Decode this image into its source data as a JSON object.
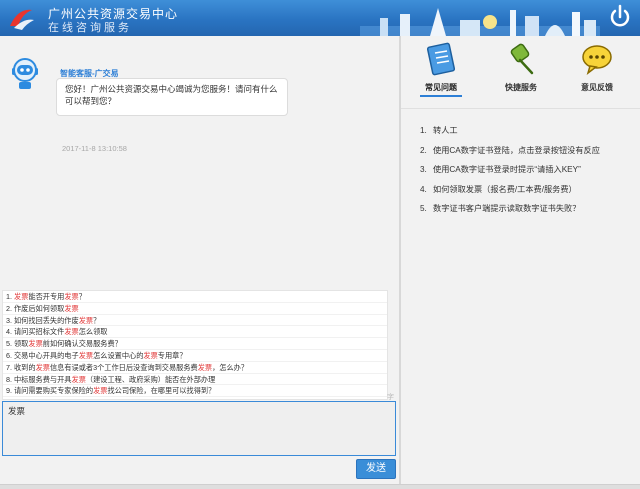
{
  "header": {
    "title_line1": "广州公共资源交易中心",
    "title_line2": "在线咨询服务"
  },
  "chat": {
    "agent_name": "智能客服-广交易",
    "greeting": "您好！广州公共资源交易中心竭诚为您服务！请问有什么可以帮到您？",
    "timestamp": "2017-11-8 13:10:58"
  },
  "suggestions": [
    [
      "1. ",
      "发票",
      "能否开专用",
      "发票",
      "？"
    ],
    [
      "2. 作废后如何领取",
      "发票",
      ""
    ],
    [
      "3. 如何找回丢失的作废",
      "发票",
      "？"
    ],
    [
      "4. 请问买招标文件",
      "发票",
      "怎么领取"
    ],
    [
      "5. 领取",
      "发票",
      "前如何确认交易服务费？"
    ],
    [
      "6. 交易中心开具的电子",
      "发票",
      "怎么设置中心的",
      "发票",
      "专用章？"
    ],
    [
      "7. 收到的",
      "发票",
      "信息有误或者3个工作日后没查询到交易服务费",
      "发票",
      "，怎么办？"
    ],
    [
      "8. 中标服务费与开具",
      "发票",
      "（建设工程、政府采购）能否在外部办理"
    ],
    [
      "9. 请问需要购买专家保险的",
      "发票",
      "找公司保险，在哪里可以找得到？"
    ]
  ],
  "input": {
    "value": "发票"
  },
  "send_label": "发送",
  "send_hint": "字",
  "tabs": [
    {
      "label": "常见问题",
      "icon": "notebook-icon",
      "active": true
    },
    {
      "label": "快捷服务",
      "icon": "pushpin-icon",
      "active": false
    },
    {
      "label": "意见反馈",
      "icon": "speech-bubble-icon",
      "active": false
    }
  ],
  "faq": [
    {
      "num": "1.",
      "text": "转人工"
    },
    {
      "num": "2.",
      "text": "使用CA数字证书登陆，点击登录按钮没有反应"
    },
    {
      "num": "3.",
      "text": "使用CA数字证书登录时提示“请插入KEY”"
    },
    {
      "num": "4.",
      "text": "如何领取发票（报名费/工本费/服务费）"
    },
    {
      "num": "5.",
      "text": "数字证书客户端提示读取数字证书失败？"
    }
  ],
  "colors": {
    "header_blue": "#2a74c2",
    "accent_blue": "#2d7fd6",
    "highlight_red": "#e23b3b",
    "send_button": "#3a8ed8"
  }
}
